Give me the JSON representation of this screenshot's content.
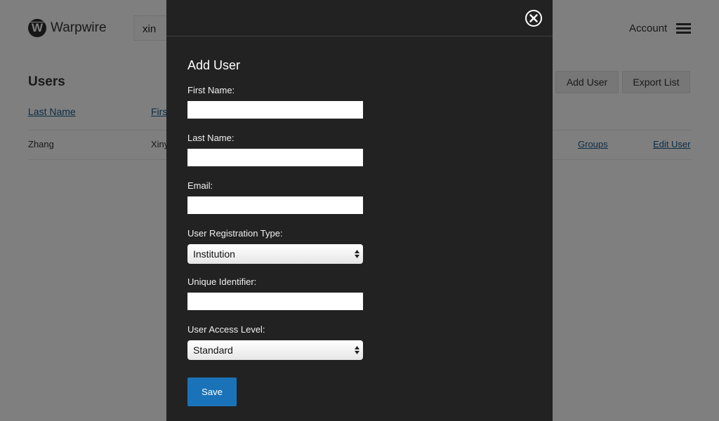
{
  "header": {
    "logo_letter": "W",
    "app_name": "Warpwire",
    "search_value": "xin",
    "account_label": "Account",
    "menu_icon": "hamburger-icon"
  },
  "users_page": {
    "title": "Users",
    "add_user_label": "Add User",
    "export_list_label": "Export List",
    "columns": [
      "Last Name",
      "First Name"
    ],
    "rows": [
      {
        "last_name": "Zhang",
        "first_name": "Xiny",
        "groups_link": "Groups",
        "edit_link": "Edit User"
      }
    ]
  },
  "modal": {
    "title": "Add User",
    "close_icon": "close-circle-icon",
    "fields": {
      "first_name": {
        "label": "First Name:",
        "value": ""
      },
      "last_name": {
        "label": "Last Name:",
        "value": ""
      },
      "email": {
        "label": "Email:",
        "value": ""
      },
      "registration_type": {
        "label": "User Registration Type:",
        "selected": "Institution"
      },
      "unique_identifier": {
        "label": "Unique Identifier:",
        "value": ""
      },
      "access_level": {
        "label": "User Access Level:",
        "selected": "Standard"
      }
    },
    "save_label": "Save",
    "accent_color": "#1a73b8"
  }
}
